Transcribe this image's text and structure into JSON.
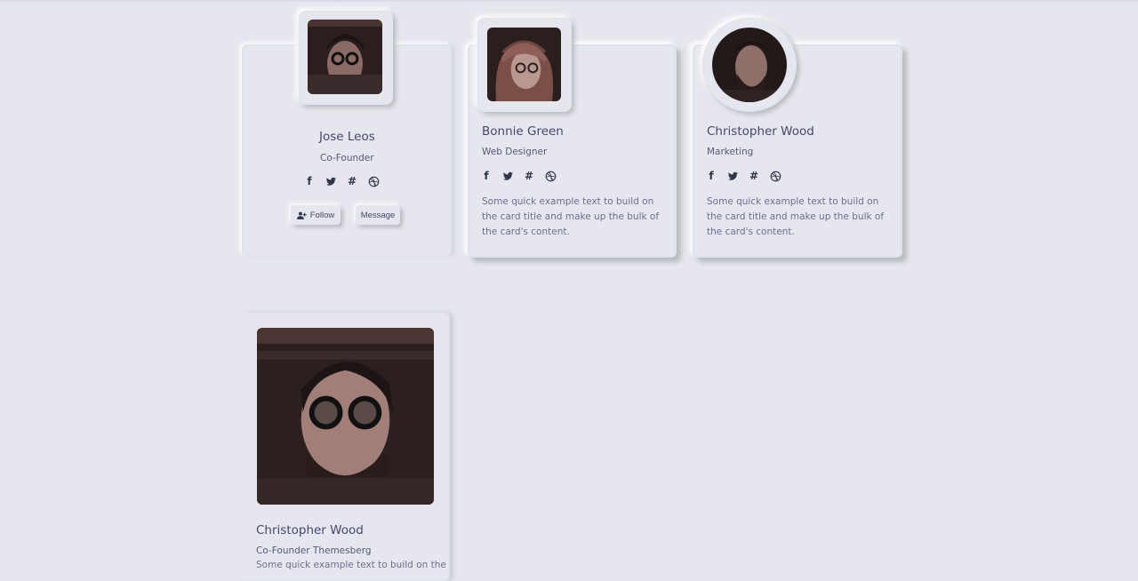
{
  "colors": {
    "background": "#e6e7ee",
    "text": "#44476a",
    "shadow_dark": "#b8b9be",
    "shadow_light": "#ffffff"
  },
  "cards": [
    {
      "name": "Jose Leos",
      "role": "Co-Founder",
      "social": [
        "facebook-icon",
        "twitter-icon",
        "slack-icon",
        "dribbble-icon"
      ],
      "buttons": {
        "follow": "Follow",
        "message": "Message"
      }
    },
    {
      "name": "Bonnie Green",
      "role": "Web Designer",
      "social": [
        "facebook-icon",
        "twitter-icon",
        "slack-icon",
        "dribbble-icon"
      ],
      "description": "Some quick example text to build on the card title and make up the bulk of the card's content."
    },
    {
      "name": "Christopher Wood",
      "role": "Marketing",
      "social": [
        "facebook-icon",
        "twitter-icon",
        "slack-icon",
        "dribbble-icon"
      ],
      "description": "Some quick example text to build on the card title and make up the bulk of the card's content."
    },
    {
      "name": "Christopher Wood",
      "role": "Co-Founder Themesberg",
      "description": "Some quick example text to build on the"
    }
  ]
}
